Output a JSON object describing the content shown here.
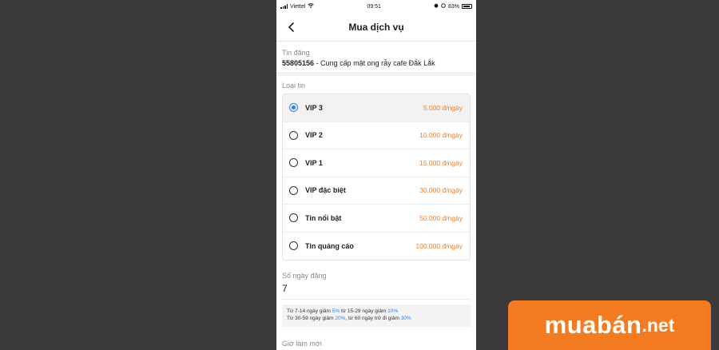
{
  "status_bar": {
    "carrier": "Viettel",
    "time": "09:51",
    "battery": "83%"
  },
  "header": {
    "title": "Mua dịch vụ"
  },
  "post": {
    "label": "Tin đăng",
    "id": "55805156",
    "title": "- Cung cấp mật ong rẫy cafe Đắk Lắk"
  },
  "listing_type": {
    "label": "Loại tin",
    "options": [
      {
        "name": "VIP 3",
        "price": "5.000 đ/ngày",
        "selected": true
      },
      {
        "name": "VIP 2",
        "price": "10.000 đ/ngày",
        "selected": false
      },
      {
        "name": "VIP 1",
        "price": "15.000 đ/ngày",
        "selected": false
      },
      {
        "name": "VIP đặc biệt",
        "price": "30.000 đ/ngày",
        "selected": false
      },
      {
        "name": "Tin nổi bật",
        "price": "50.000 đ/ngày",
        "selected": false
      },
      {
        "name": "Tin quảng cáo",
        "price": "100.000 đ/ngày",
        "selected": false
      }
    ]
  },
  "days": {
    "label": "Số ngày đăng",
    "value": "7"
  },
  "promo": {
    "line1_a": "Từ 7-14 ngày giảm ",
    "line1_pct1": "5%",
    "line1_b": " từ 15-29 ngày giảm ",
    "line1_pct2": "10%",
    "line2_a": "Từ 30-59 ngày giảm ",
    "line2_pct1": "20%",
    "line2_b": ", từ 60 ngày trở đi giảm ",
    "line2_pct2": "30%"
  },
  "renew": {
    "label": "Giờ làm mới"
  },
  "watermark": {
    "brand": "muabán",
    "tld": ".net"
  },
  "colors": {
    "accent_orange": "#f47b20",
    "radio_blue": "#2f80ed",
    "backdrop": "#3a3a3a"
  }
}
